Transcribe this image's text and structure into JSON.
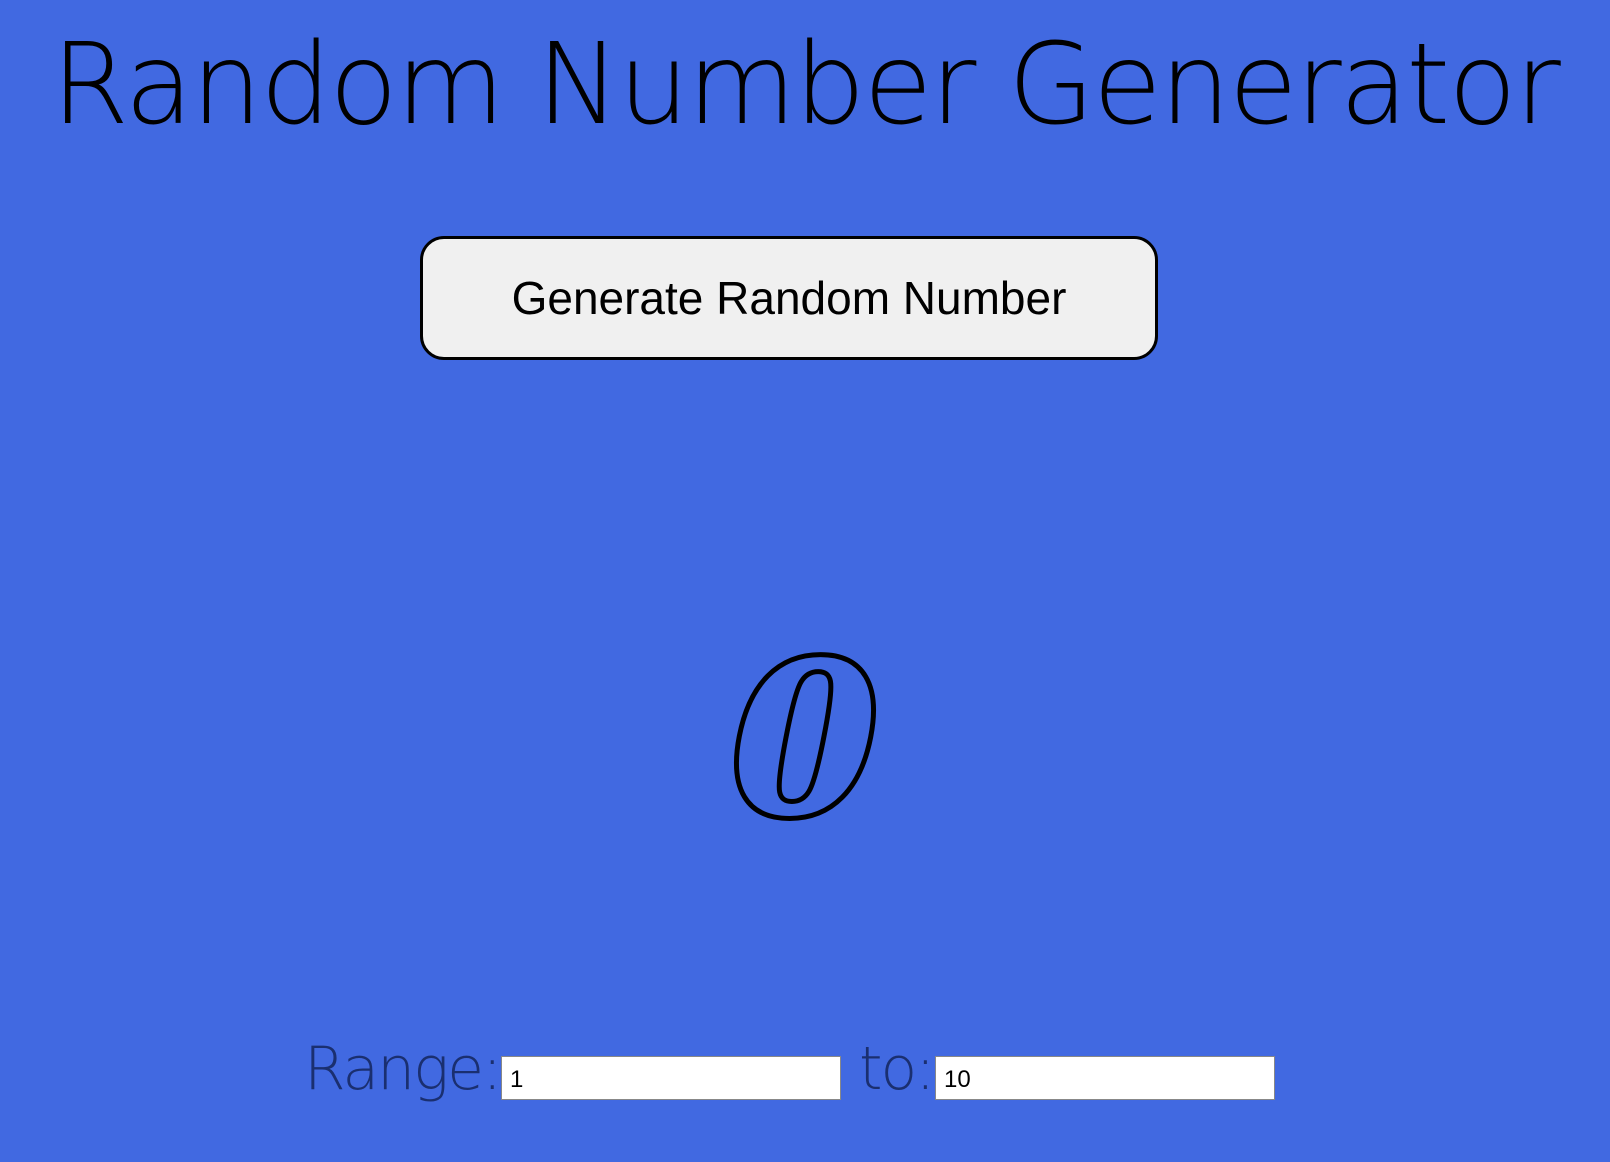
{
  "page": {
    "title": "Random Number Generator",
    "background_color": "#4169e1"
  },
  "generator": {
    "button_label": "Generate Random Number",
    "result": "0"
  },
  "range": {
    "label": "Range:",
    "min_value": "1",
    "to_label": "to:",
    "max_value": "10"
  }
}
